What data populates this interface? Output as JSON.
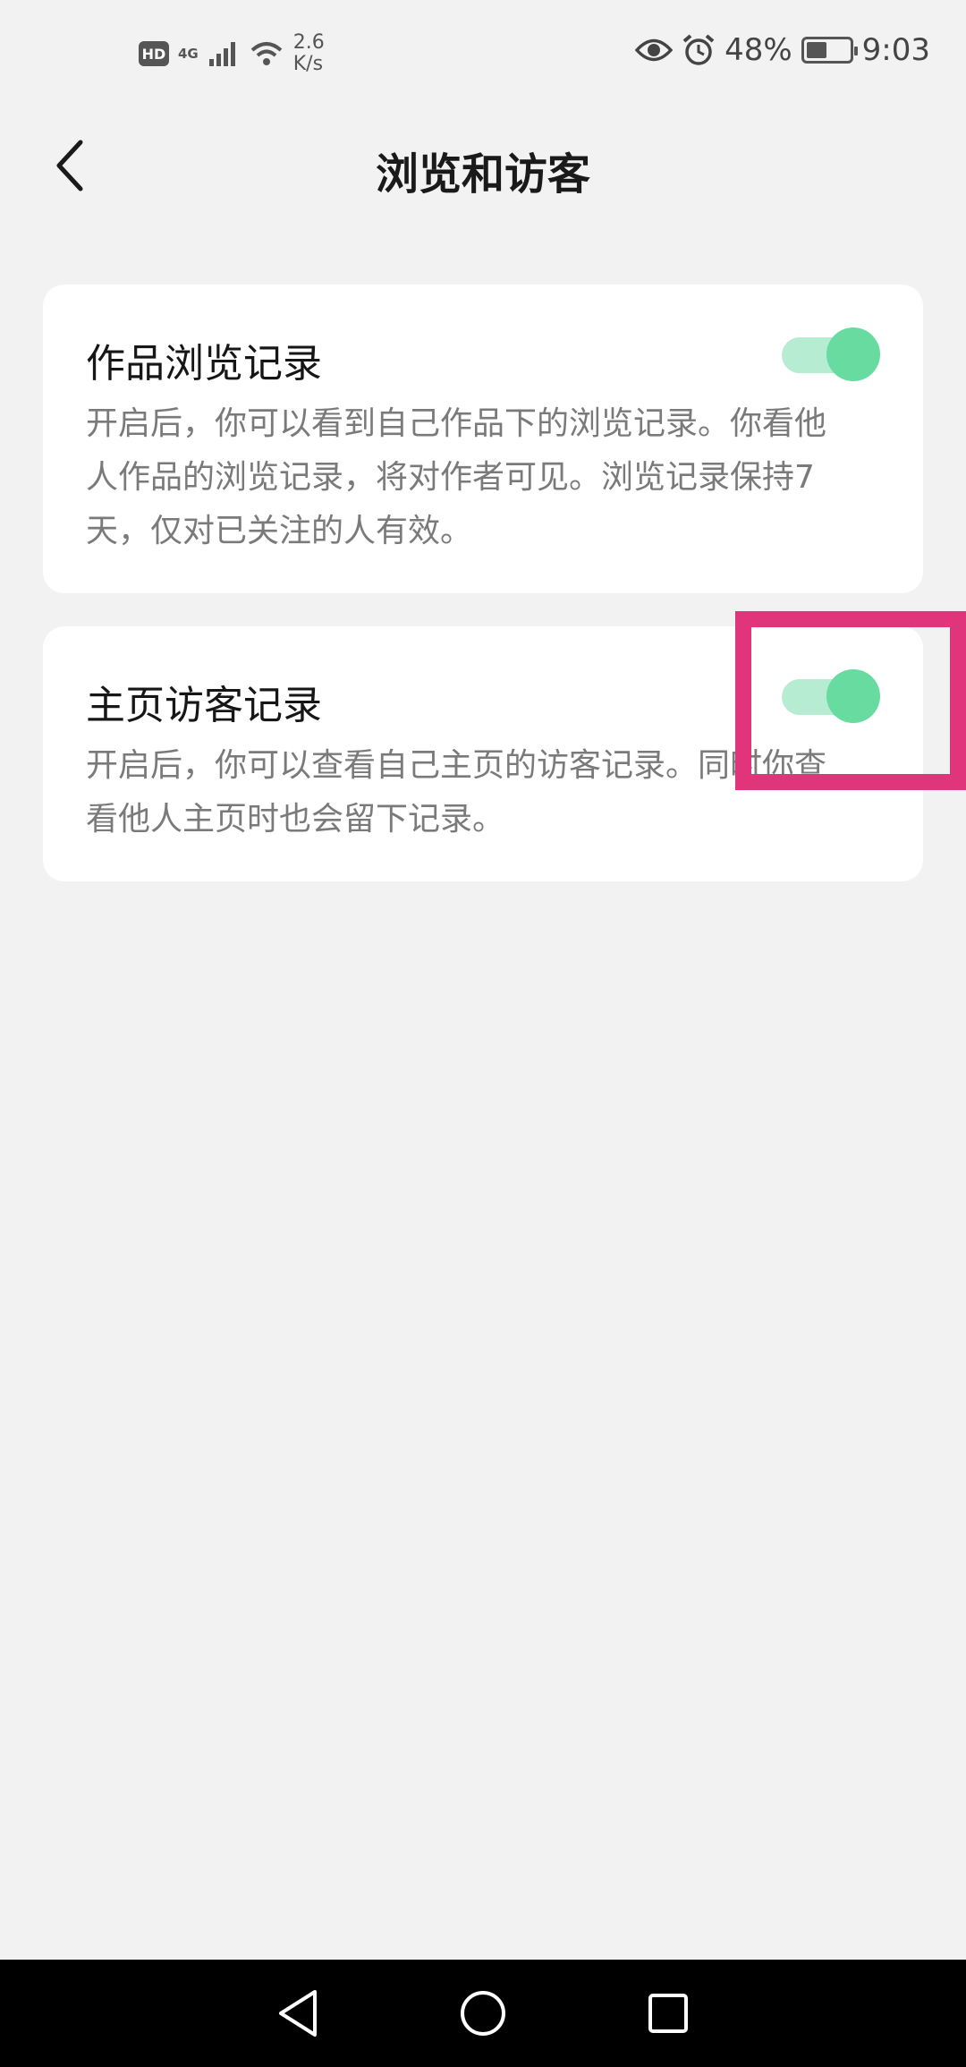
{
  "status_bar": {
    "hd": "HD",
    "network": "4G",
    "speed_value": "2.6",
    "speed_unit": "K/s",
    "battery_percent": "48%",
    "battery_level": 0.48,
    "time": "9:03",
    "icons": [
      "signal-icon",
      "wifi-icon",
      "eye-icon",
      "alarm-icon",
      "battery-icon"
    ]
  },
  "header": {
    "title": "浏览和访客",
    "back_icon": "chevron-left-icon"
  },
  "settings": [
    {
      "title": "作品浏览记录",
      "description": "开启后，你可以看到自己作品下的浏览记录。你看他人作品的浏览记录，将对作者可见。浏览记录保持7天，仅对已关注的人有效。",
      "enabled": true
    },
    {
      "title": "主页访客记录",
      "description": "开启后，你可以查看自己主页的访客记录。同时你查看他人主页时也会留下记录。",
      "enabled": true
    }
  ],
  "colors": {
    "toggle_track": "#b6ecd2",
    "toggle_thumb": "#67dba0",
    "highlight": "#e0357a",
    "background": "#f2f2f2"
  },
  "nav_bar": {
    "icons": [
      "back-triangle-icon",
      "home-circle-icon",
      "recents-square-icon"
    ]
  }
}
